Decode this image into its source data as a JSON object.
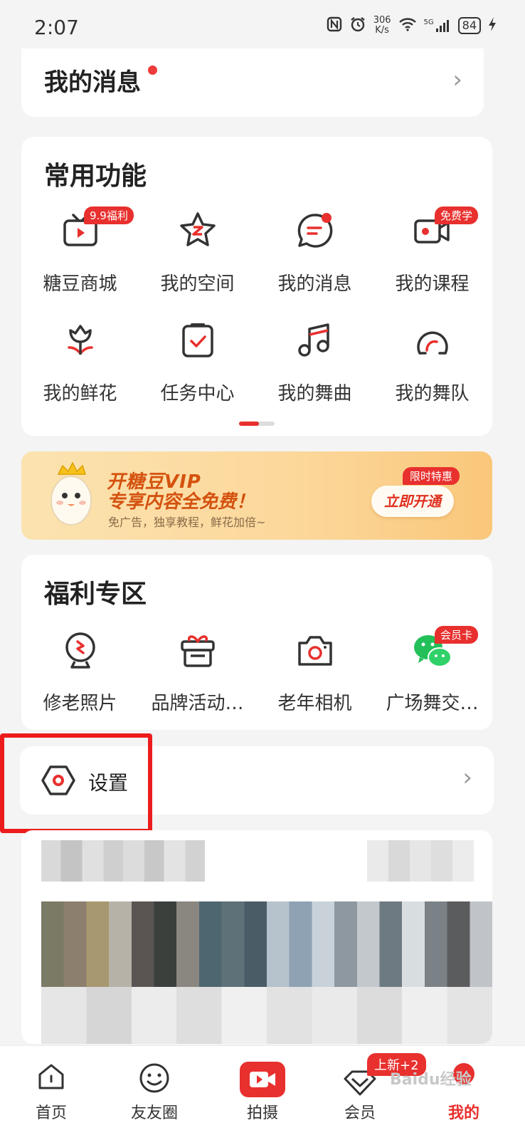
{
  "status": {
    "time": "2:07",
    "net_speed_value": "306",
    "net_speed_unit": "K/s",
    "network": "5G",
    "battery": "84"
  },
  "messages": {
    "title": "我的消息"
  },
  "features": {
    "title": "常用功能",
    "items": [
      {
        "label": "糖豆商城",
        "icon": "shop-tv-icon",
        "badge": "9.9福利"
      },
      {
        "label": "我的空间",
        "icon": "star-z-icon",
        "badge": ""
      },
      {
        "label": "我的消息",
        "icon": "message-icon",
        "badge": ""
      },
      {
        "label": "我的课程",
        "icon": "video-camera-icon",
        "badge": "免费学"
      },
      {
        "label": "我的鲜花",
        "icon": "flower-icon",
        "badge": ""
      },
      {
        "label": "任务中心",
        "icon": "task-clipboard-icon",
        "badge": ""
      },
      {
        "label": "我的舞曲",
        "icon": "music-note-icon",
        "badge": ""
      },
      {
        "label": "我的舞队",
        "icon": "team-icon",
        "badge": ""
      }
    ]
  },
  "vip": {
    "line1": "开糖豆VIP",
    "line2": "专享内容全免费！",
    "sub": "免广告，独享教程，鲜花加倍~",
    "badge": "限时特惠",
    "button": "立即开通"
  },
  "welfare": {
    "title": "福利专区",
    "items": [
      {
        "label": "修老照片",
        "icon": "photo-restore-icon",
        "badge": ""
      },
      {
        "label": "品牌活动…",
        "icon": "gift-icon",
        "badge": ""
      },
      {
        "label": "老年相机",
        "icon": "camera-icon",
        "badge": ""
      },
      {
        "label": "广场舞交…",
        "icon": "wechat-icon",
        "badge": "会员卡"
      }
    ]
  },
  "settings": {
    "label": "设置"
  },
  "tabs": [
    {
      "label": "首页",
      "icon": "home-icon"
    },
    {
      "label": "友友圈",
      "icon": "smile-icon"
    },
    {
      "label": "拍摄",
      "icon": "record-icon"
    },
    {
      "label": "会员",
      "icon": "diamond-icon",
      "badge": "上新+2"
    },
    {
      "label": "我的",
      "icon": "profile-icon"
    }
  ],
  "watermark": "Baidu经验",
  "colors": {
    "accent": "#e8302e",
    "highlight_frame": "#ed1c1c",
    "vip_text": "#d4520f"
  }
}
